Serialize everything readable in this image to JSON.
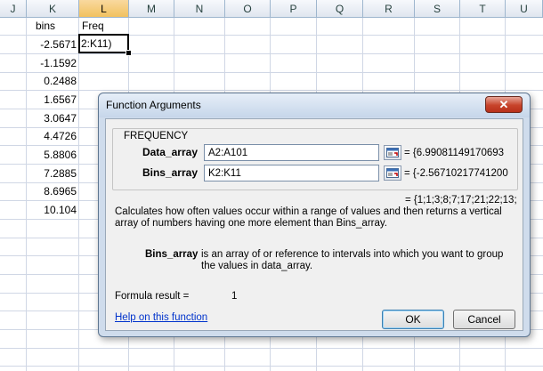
{
  "sheet": {
    "columns": [
      "J",
      "K",
      "L",
      "M",
      "N",
      "O",
      "P",
      "Q",
      "R",
      "S",
      "T",
      "U"
    ],
    "selected_column": "L",
    "header_bins": "bins",
    "header_freq": "Freq",
    "bins": [
      "-2.5671",
      "-1.1592",
      "0.2488",
      "1.6567",
      "3.0647",
      "4.4726",
      "5.8806",
      "7.2885",
      "8.6965",
      "10.104"
    ],
    "active_cell_text": "2:K11)"
  },
  "dialog": {
    "title": "Function Arguments",
    "close_label": "✕",
    "function_name": "FREQUENCY",
    "args": [
      {
        "label": "Data_array",
        "value": "A2:A101",
        "evaluated": "= {6.99081149170693"
      },
      {
        "label": "Bins_array",
        "value": "K2:K11",
        "evaluated": "= {-2.56710217741200"
      }
    ],
    "result_preview": "= {1;1;3;8;7;17;21;22;13;",
    "description": "Calculates how often values occur within a range of values and then returns a vertical array of numbers having one more element than Bins_array.",
    "arg_desc_name": "Bins_array",
    "arg_desc_text": "is an array of or reference to intervals into which you want to group the values in data_array.",
    "formula_result_label": "Formula result =",
    "formula_result_value": "1",
    "help_link": "Help on this function",
    "ok_label": "OK",
    "cancel_label": "Cancel"
  }
}
